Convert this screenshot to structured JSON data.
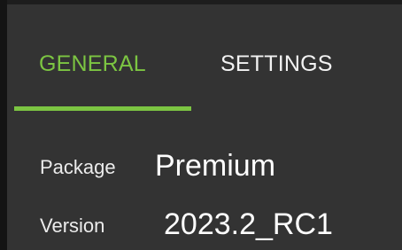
{
  "tabs": {
    "items": [
      {
        "label": "GENERAL",
        "active": true
      },
      {
        "label": "SETTINGS",
        "active": false
      }
    ],
    "active_color": "#7cc542"
  },
  "details": {
    "package": {
      "label": "Package",
      "value": "Premium"
    },
    "version": {
      "label": "Version",
      "value": "2023.2_RC1"
    }
  },
  "colors": {
    "background": "#333333",
    "text": "#f2f2f2",
    "accent": "#7cc542"
  }
}
